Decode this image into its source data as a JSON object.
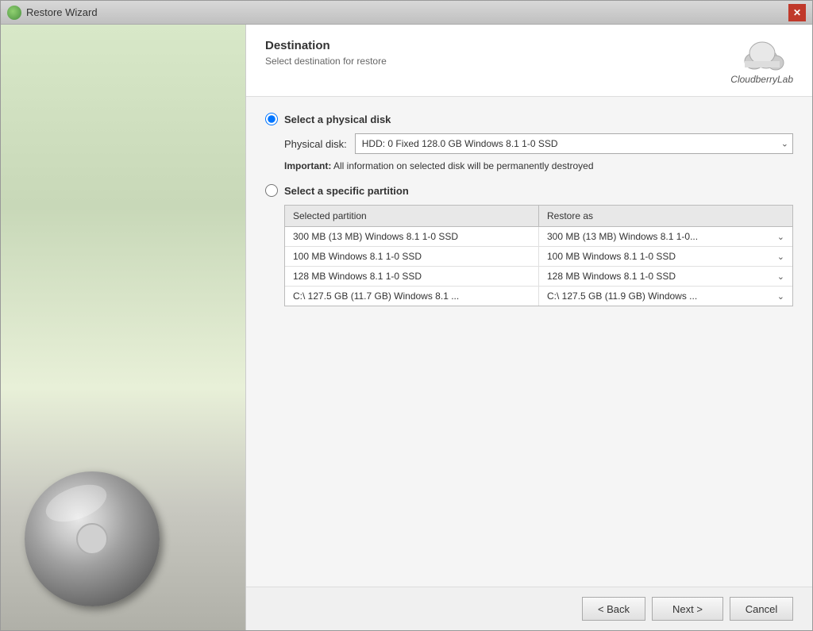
{
  "window": {
    "title": "Restore Wizard",
    "close_label": "✕"
  },
  "header": {
    "title": "Destination",
    "subtitle": "Select destination for restore",
    "logo_text": "CloudberryLab"
  },
  "options": {
    "physical_disk_label": "Select a physical disk",
    "physical_disk_radio_checked": true,
    "partition_label": "Select a specific partition",
    "partition_radio_checked": false,
    "disk_field_label": "Physical disk:",
    "disk_value": "HDD: 0 Fixed 128.0 GB Windows 8.1 1-0 SSD",
    "important_label": "Important:",
    "important_text": "All information on selected disk will be permanently destroyed"
  },
  "table": {
    "col1_header": "Selected partition",
    "col2_header": "Restore as",
    "rows": [
      {
        "partition": "300 MB (13 MB) Windows 8.1 1-0 SSD",
        "restore_as": "300 MB (13 MB) Windows 8.1 1-0..."
      },
      {
        "partition": "100 MB Windows 8.1 1-0 SSD",
        "restore_as": "100 MB Windows 8.1 1-0 SSD"
      },
      {
        "partition": "128 MB Windows 8.1 1-0 SSD",
        "restore_as": "128 MB Windows 8.1 1-0 SSD"
      },
      {
        "partition": "C:\\ 127.5 GB (11.7 GB) Windows 8.1 ...",
        "restore_as": "C:\\ 127.5 GB (11.9 GB) Windows ..."
      }
    ]
  },
  "footer": {
    "back_label": "< Back",
    "next_label": "Next >",
    "cancel_label": "Cancel"
  }
}
